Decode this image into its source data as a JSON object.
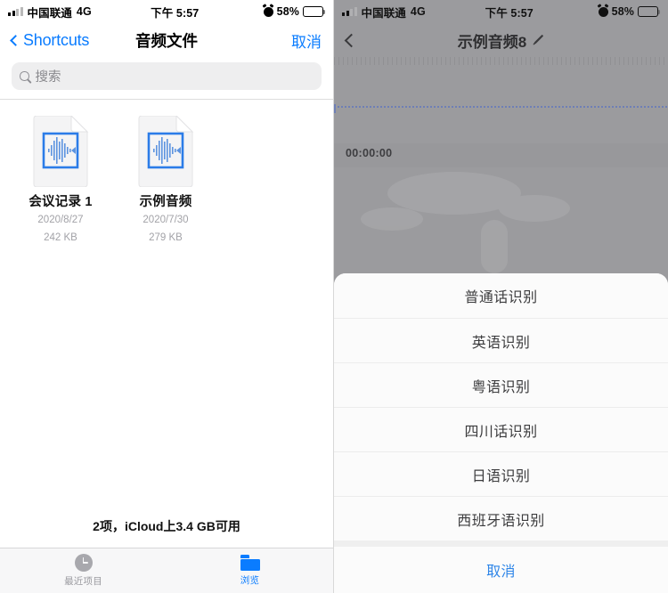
{
  "status_bar": {
    "carrier": "中国联通",
    "network": "4G",
    "time": "下午 5:57",
    "battery_percent": "58%",
    "battery_level": 58,
    "alarm_icon": "alarm-clock-icon",
    "signal_icon": "signal-bars-icon",
    "battery_icon": "battery-icon"
  },
  "left_panel": {
    "navbar": {
      "back_label": "Shortcuts",
      "back_icon": "chevron-left-icon",
      "title": "音频文件",
      "right_action": "取消"
    },
    "search": {
      "placeholder": "搜索",
      "icon": "search-icon",
      "value": ""
    },
    "files": [
      {
        "name": "会议记录 1",
        "date": "2020/8/27",
        "size": "242 KB",
        "icon": "audio-document-icon"
      },
      {
        "name": "示例音频",
        "date": "2020/7/30",
        "size": "279 KB",
        "icon": "audio-document-icon"
      }
    ],
    "footer_status": "2项，iCloud上3.4 GB可用",
    "tabs": [
      {
        "label": "最近项目",
        "icon": "clock-icon",
        "active": false
      },
      {
        "label": "浏览",
        "icon": "folder-icon",
        "active": true
      }
    ]
  },
  "right_panel": {
    "navbar": {
      "back_icon": "chevron-left-icon",
      "title": "示例音频8",
      "edit_icon": "pencil-icon"
    },
    "editor": {
      "timecode": "00:00:00",
      "ruler_icon": "timeline-ruler",
      "playhead_icon": "playhead-marker"
    },
    "action_sheet": {
      "options": [
        "普通话识别",
        "英语识别",
        "粤语识别",
        "四川话识别",
        "日语识别",
        "西班牙语识别"
      ],
      "cancel_label": "取消"
    }
  },
  "colors": {
    "accent_blue": "#0a7cff",
    "cancel_blue": "#2f86e8",
    "overlay_gray": "#9b9b9e",
    "sheet_bg": "#fbfbfb",
    "muted_text": "#a2a2a7"
  }
}
